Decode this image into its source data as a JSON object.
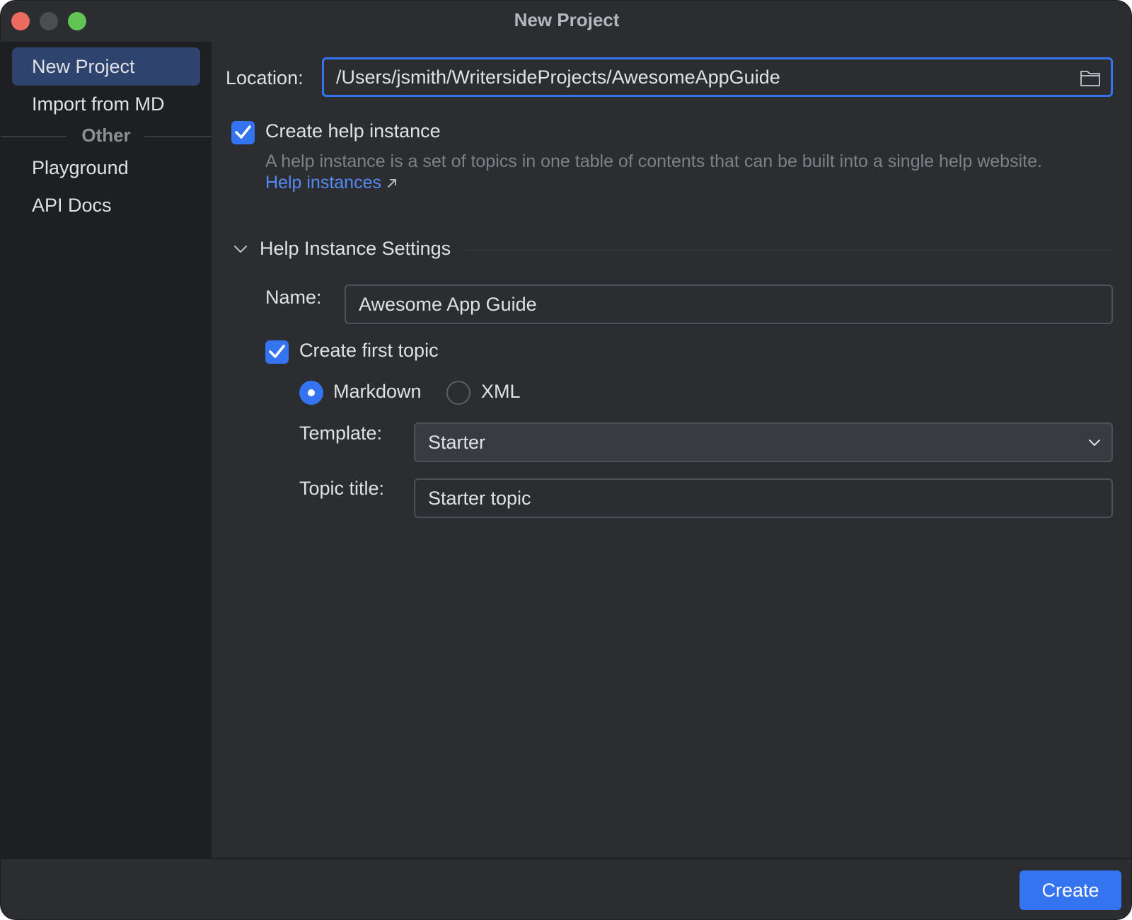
{
  "window": {
    "title": "New Project"
  },
  "sidebar": {
    "items": [
      {
        "label": "New Project",
        "selected": true
      },
      {
        "label": "Import from MD",
        "selected": false
      }
    ],
    "group_label": "Other",
    "other_items": [
      {
        "label": "Playground"
      },
      {
        "label": "API Docs"
      }
    ]
  },
  "form": {
    "location_label": "Location:",
    "location_value": "/Users/jsmith/WritersideProjects/AwesomeAppGuide",
    "create_help_instance": {
      "label": "Create help instance",
      "checked": true
    },
    "description": "A help instance is a set of topics in one table of contents that can be built into a single help website.",
    "description_link": "Help instances",
    "section_title": "Help Instance Settings",
    "name_label": "Name:",
    "name_value": "Awesome App Guide",
    "create_first_topic": {
      "label": "Create first topic",
      "checked": true
    },
    "format_options": [
      {
        "label": "Markdown",
        "selected": true
      },
      {
        "label": "XML",
        "selected": false
      }
    ],
    "template_label": "Template:",
    "template_value": "Starter",
    "topic_title_label": "Topic title:",
    "topic_title_value": "Starter topic"
  },
  "footer": {
    "create_label": "Create"
  },
  "colors": {
    "accent": "#3574f0",
    "link": "#548af7",
    "sidebar_bg": "#1e1f22",
    "panel_bg": "#2b2d30",
    "selected_bg": "#2e436e"
  },
  "icons": [
    "folder-icon",
    "checkmark-icon",
    "external-link-icon",
    "chevron-down-icon"
  ]
}
